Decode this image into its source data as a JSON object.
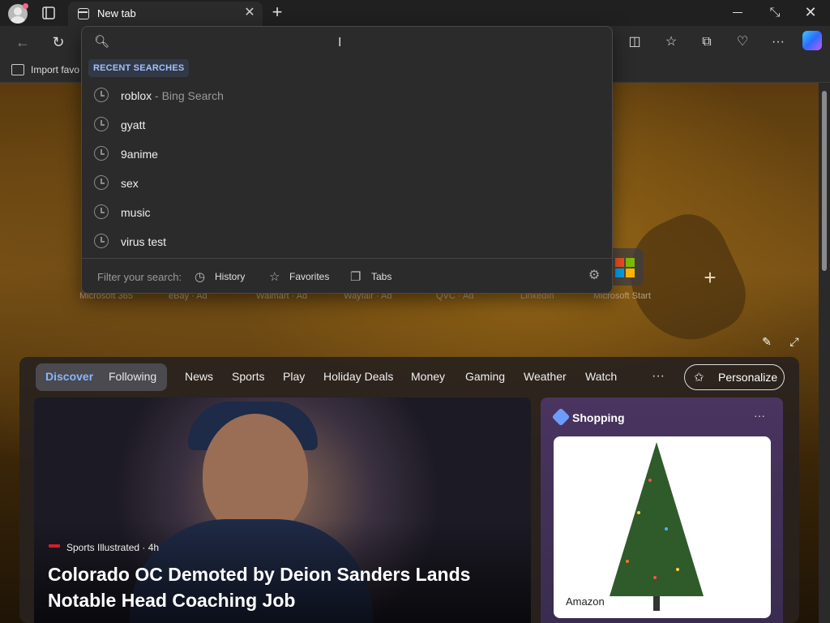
{
  "browser": {
    "tab_title": "New tab",
    "favorites_bar_item": "Import favo"
  },
  "search_dropdown": {
    "input_value": "",
    "section_header": "RECENT SEARCHES",
    "recent": [
      {
        "query": "roblox",
        "suffix": " - Bing Search"
      },
      {
        "query": "gyatt",
        "suffix": ""
      },
      {
        "query": "9anime",
        "suffix": ""
      },
      {
        "query": "sex",
        "suffix": ""
      },
      {
        "query": "music",
        "suffix": ""
      },
      {
        "query": "virus test",
        "suffix": ""
      }
    ],
    "filter_label": "Filter your search:",
    "filters": [
      "History",
      "Favorites",
      "Tabs"
    ]
  },
  "quick_links": [
    "Microsoft 365",
    "eBay · Ad",
    "Walmart · Ad",
    "Wayfair · Ad",
    "QVC · Ad",
    "LinkedIn",
    "Microsoft Start"
  ],
  "feed": {
    "pills": {
      "discover": "Discover",
      "following": "Following"
    },
    "tabs": [
      "News",
      "Sports",
      "Play",
      "Holiday Deals",
      "Money",
      "Gaming",
      "Weather",
      "Watch"
    ],
    "more": "···",
    "personalize_label": "Personalize",
    "hero": {
      "source": "Sports Illustrated · 4h",
      "headline": "Colorado OC Demoted by Deion Sanders Lands Notable Head Coaching Job"
    },
    "shopping": {
      "title": "Shopping",
      "merchant": "Amazon"
    }
  },
  "colors": {
    "accent_blue": "#8ab4ff",
    "ms_logo": [
      "#f25022",
      "#7fba00",
      "#00a4ef",
      "#ffb900"
    ]
  },
  "icons": [
    "avatar-icon",
    "tab-actions-icon",
    "new-tab-icon",
    "close-icon",
    "minimize-icon",
    "restore-icon",
    "back-icon",
    "refresh-icon",
    "split-screen-icon",
    "favorites-icon",
    "collections-icon",
    "browser-essentials-icon",
    "more-icon",
    "copilot-icon",
    "search-icon",
    "history-icon",
    "star-icon",
    "tabs-icon",
    "gear-icon"
  ]
}
